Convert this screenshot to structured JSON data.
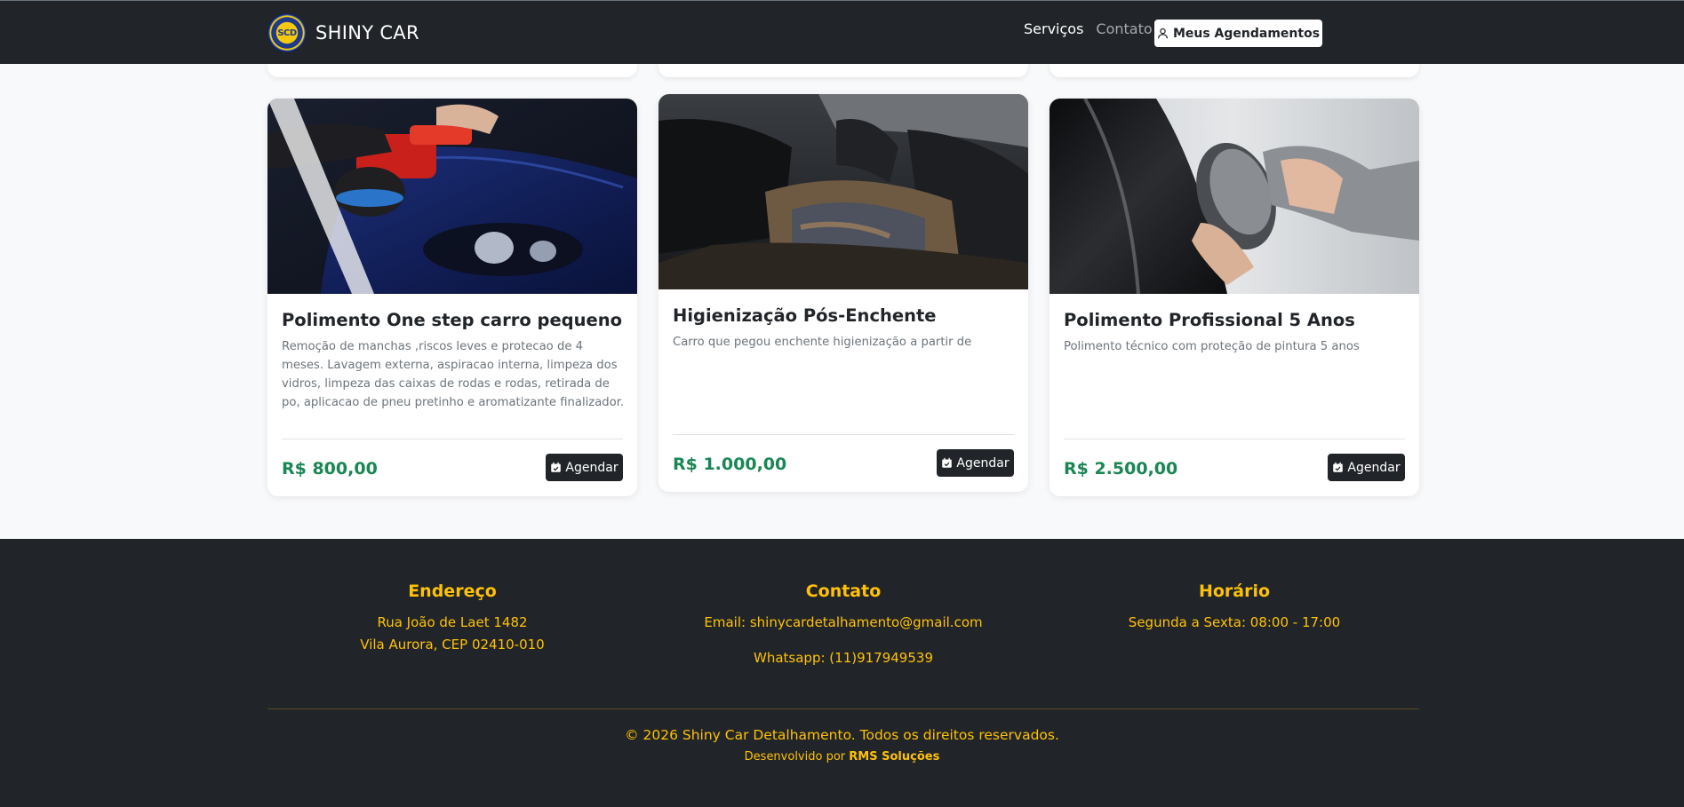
{
  "navbar": {
    "brand_name": "SHINY CAR",
    "logo_text": "SCD",
    "links": [
      {
        "label": "Serviços",
        "active": true
      },
      {
        "label": "Contato",
        "active": false
      }
    ],
    "appointments_label": "Meus Agendamentos"
  },
  "services": [
    {
      "title": "Polimento One step carro pequeno",
      "description": "Remoção de manchas ,riscos leves e protecao de 4 meses. Lavagem externa, aspiracao interna, limpeza dos vidros, limpeza das caixas de rodas e rodas, retirada de po, aplicacao de pneu pretinho e aromatizante finalizador.",
      "price": "R$ 800,00",
      "button_label": "Agendar"
    },
    {
      "title": "Higienização Pós-Enchente",
      "description": "Carro que pegou enchente higienização a partir de",
      "price": "R$ 1.000,00",
      "button_label": "Agendar"
    },
    {
      "title": "Polimento Profissional 5 Anos",
      "description": "Polimento técnico com proteção de pintura 5 anos",
      "price": "R$ 2.500,00",
      "button_label": "Agendar"
    }
  ],
  "footer": {
    "address": {
      "heading": "Endereço",
      "line1": "Rua João de Laet 1482",
      "line2": "Vila Aurora, CEP 02410-010"
    },
    "contact": {
      "heading": "Contato",
      "email": "Email: shinycardetalhamento@gmail.com",
      "whatsapp": "Whatsapp: (11)917949539"
    },
    "hours": {
      "heading": "Horário",
      "line1": "Segunda a Sexta: 08:00 - 17:00"
    },
    "copyright": "© 2026 Shiny Car Detalhamento. Todos os direitos reservados.",
    "developed_by_prefix": "Desenvolvido por",
    "developer_name": "RMS Soluções"
  },
  "colors": {
    "navbar_bg": "#212529",
    "price_green": "#198754",
    "footer_text": "#ffc107",
    "page_bg": "#f8f9fa"
  }
}
